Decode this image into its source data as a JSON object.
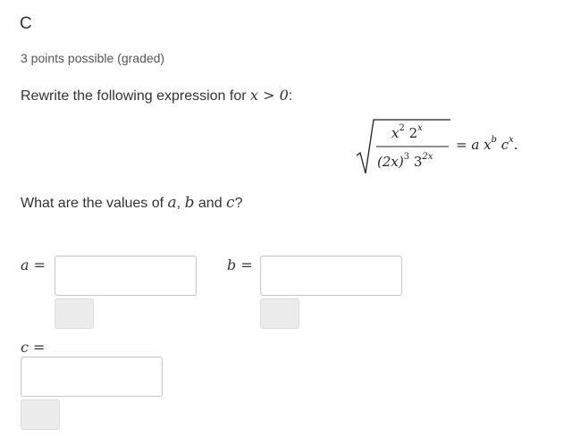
{
  "problem": {
    "title": "C",
    "points": "3 points possible (graded)"
  },
  "prompt": {
    "text_before": "Rewrite the following expression for ",
    "math": "x > 0",
    "text_after": ":"
  },
  "equation": {
    "num_base1": "x",
    "num_exp1": "2",
    "num_base2": "2",
    "num_exp2": "x",
    "den_base": "(2x)",
    "den_exp1": "3",
    "den_base2": "3",
    "den_exp2": "2x",
    "rhs_eq": "= ",
    "rhs_a": "a",
    "rhs_x": "x",
    "rhs_b": "b",
    "rhs_c": "c",
    "rhs_cexp": "x",
    "rhs_end": "."
  },
  "question": {
    "text_before": "What are the values of ",
    "var_a": "a",
    "sep1": ", ",
    "var_b": "b",
    "text_and": " and ",
    "var_c": "c",
    "text_after": "?"
  },
  "fields": {
    "a_label": "a =",
    "a_value": "",
    "b_label": "b =",
    "b_value": "",
    "c_label": "c =",
    "c_value": ""
  }
}
